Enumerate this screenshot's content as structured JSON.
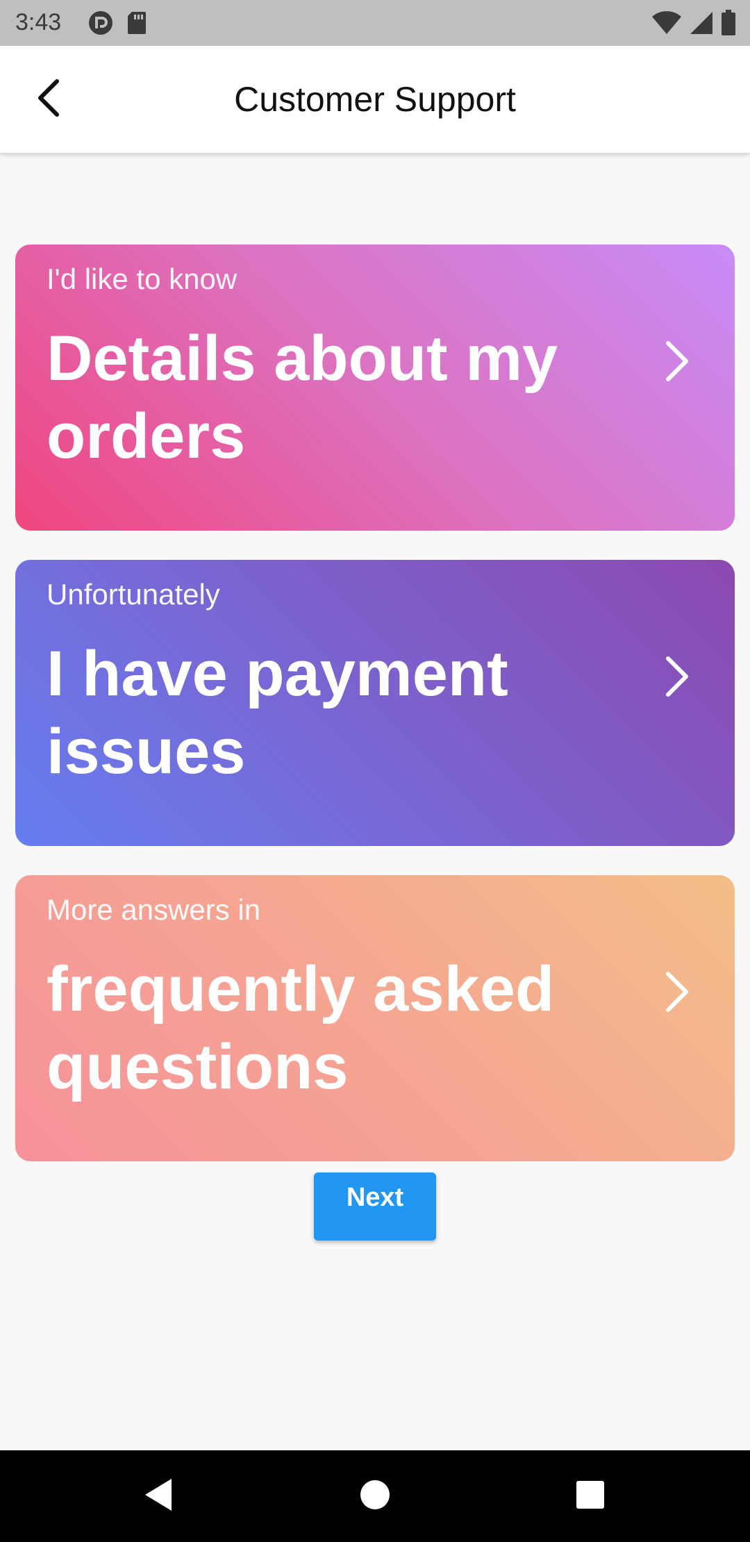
{
  "status_bar": {
    "time": "3:43",
    "icons_left": [
      "notification-icon",
      "sd-card-icon"
    ],
    "icons_right": [
      "wifi-icon",
      "signal-icon",
      "battery-icon"
    ]
  },
  "app_bar": {
    "title": "Customer Support",
    "back_icon": "arrow-back-icon"
  },
  "cards": [
    {
      "subtitle": "I'd like to know",
      "title": "Details about my orders",
      "gradient": [
        "#f0467f",
        "#c88cf8"
      ],
      "icon": "chevron-right-icon"
    },
    {
      "subtitle": "Unfortunately",
      "title": "I have payment issues",
      "gradient": [
        "#667ef0",
        "#8c49b0"
      ],
      "icon": "chevron-right-icon"
    },
    {
      "subtitle": "More answers in",
      "title": "frequently asked questions",
      "gradient": [
        "#f6919a",
        "#f3be88"
      ],
      "icon": "chevron-right-icon"
    }
  ],
  "next_button": {
    "label": "Next",
    "color": "#2196f3"
  },
  "nav_bar": {
    "icons": [
      "nav-back-icon",
      "nav-home-icon",
      "nav-recents-icon"
    ]
  }
}
